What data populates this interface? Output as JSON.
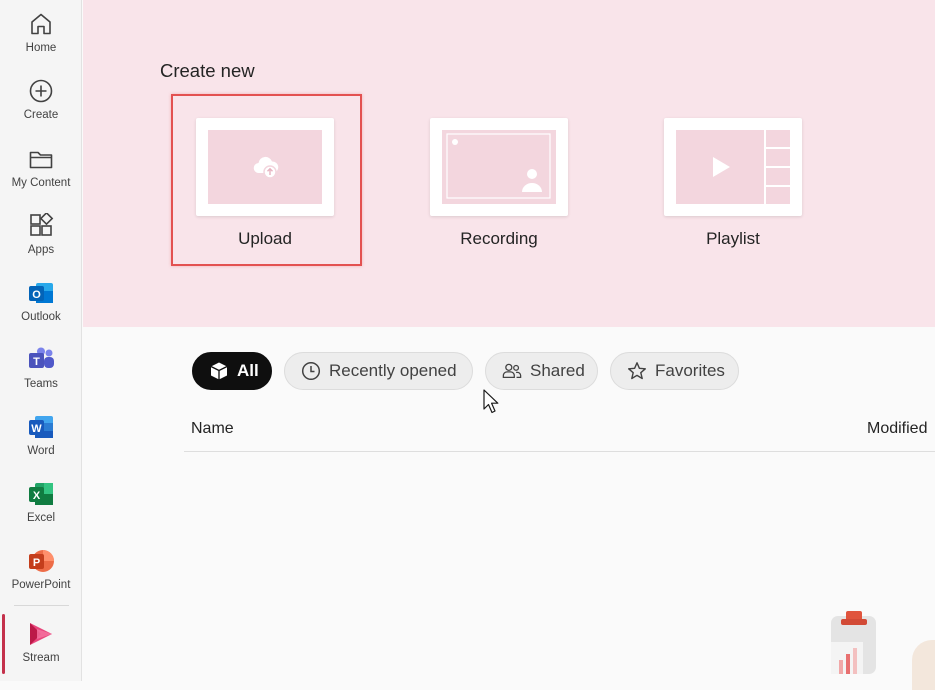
{
  "sidebar": {
    "items": [
      {
        "label": "Home",
        "icon": "home-icon"
      },
      {
        "label": "Create",
        "icon": "create-icon"
      },
      {
        "label": "My Content",
        "icon": "folder-icon"
      },
      {
        "label": "Apps",
        "icon": "apps-icon"
      },
      {
        "label": "Outlook",
        "icon": "outlook-icon"
      },
      {
        "label": "Teams",
        "icon": "teams-icon"
      },
      {
        "label": "Word",
        "icon": "word-icon"
      },
      {
        "label": "Excel",
        "icon": "excel-icon"
      },
      {
        "label": "PowerPoint",
        "icon": "powerpoint-icon"
      },
      {
        "label": "Stream",
        "icon": "stream-icon",
        "active": true
      }
    ],
    "active_color": "#c4314b"
  },
  "hero": {
    "title": "Create new",
    "background": "#f9e4ea",
    "cards": [
      {
        "label": "Upload",
        "icon": "cloud-upload-icon",
        "highlighted": true
      },
      {
        "label": "Recording",
        "icon": "screen-recording-icon"
      },
      {
        "label": "Playlist",
        "icon": "playlist-icon"
      }
    ],
    "highlight_color": "#e35151"
  },
  "filters": [
    {
      "label": "All",
      "icon": "cube-icon",
      "active": true
    },
    {
      "label": "Recently opened",
      "icon": "clock-icon"
    },
    {
      "label": "Shared",
      "icon": "people-icon"
    },
    {
      "label": "Favorites",
      "icon": "star-icon"
    }
  ],
  "table": {
    "columns": [
      "Name",
      "Modified"
    ]
  }
}
